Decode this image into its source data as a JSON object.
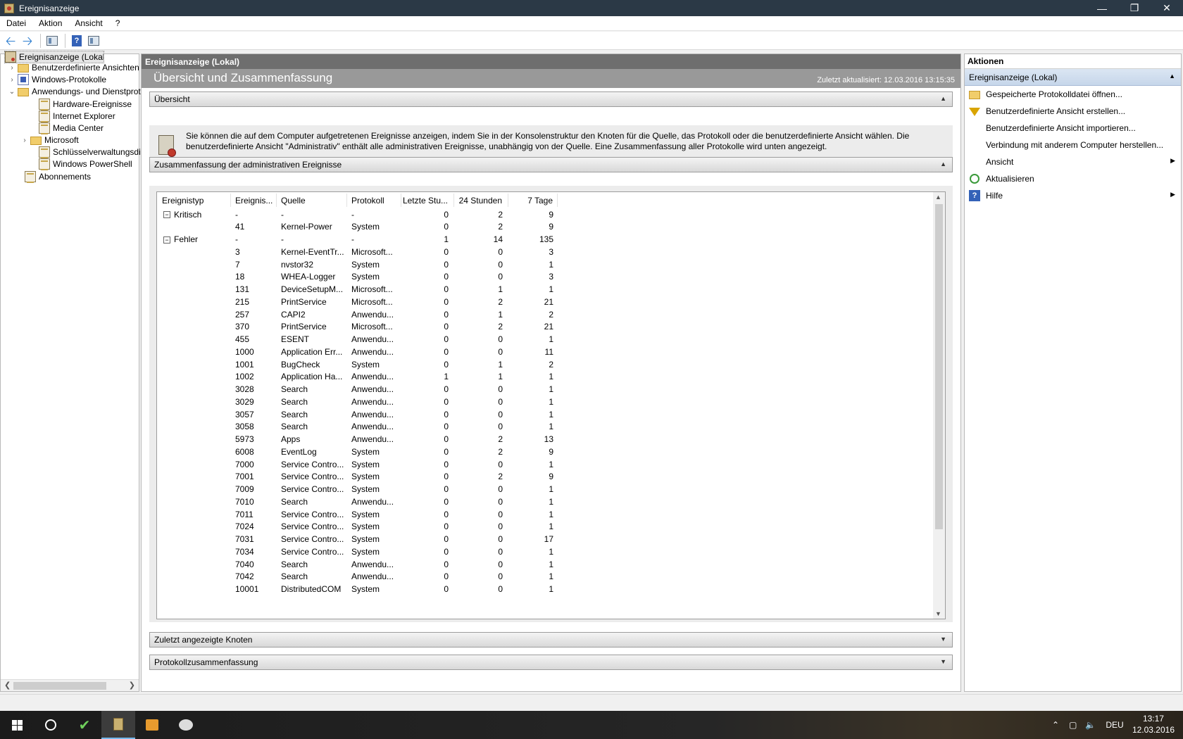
{
  "window": {
    "title": "Ereignisanzeige"
  },
  "menu": [
    "Datei",
    "Aktion",
    "Ansicht",
    "?"
  ],
  "tree": {
    "root": "Ereignisanzeige (Lokal)",
    "items": [
      {
        "label": "Benutzerdefinierte Ansichten",
        "icon": "folder-icon",
        "expander": "›"
      },
      {
        "label": "Windows-Protokolle",
        "icon": "windows-log-icon",
        "expander": "›"
      },
      {
        "label": "Anwendungs- und Dienstprotokolle",
        "icon": "folder-icon",
        "expander": "⌄"
      },
      {
        "label": "Hardware-Ereignisse",
        "icon": "log-icon",
        "expander": ""
      },
      {
        "label": "Internet Explorer",
        "icon": "log-icon",
        "expander": ""
      },
      {
        "label": "Media Center",
        "icon": "log-icon",
        "expander": ""
      },
      {
        "label": "Microsoft",
        "icon": "folder-icon",
        "expander": "›"
      },
      {
        "label": "Schlüsselverwaltungsdienst",
        "icon": "log-icon",
        "expander": ""
      },
      {
        "label": "Windows PowerShell",
        "icon": "log-icon",
        "expander": ""
      },
      {
        "label": "Abonnements",
        "icon": "subscription-icon",
        "expander": ""
      }
    ]
  },
  "center": {
    "header": "Ereignisanzeige (Lokal)",
    "title": "Übersicht und Zusammenfassung",
    "updated": "Zuletzt aktualisiert: 12.03.2016 13:15:35",
    "overview_label": "Übersicht",
    "overview_text": "Sie können die auf dem Computer aufgetretenen Ereignisse anzeigen, indem Sie in der Konsolenstruktur den Knoten für die Quelle, das Protokoll oder die benutzerdefinierte Ansicht wählen. Die benutzerdefinierte Ansicht \"Administrativ\" enthält alle administrativen Ereignisse, unabhängig von der Quelle. Eine Zusammenfassung aller Protokolle wird unten angezeigt.",
    "summary_label": "Zusammenfassung der administrativen Ereignisse",
    "recent_nodes_label": "Zuletzt angezeigte Knoten",
    "log_summary_label": "Protokollzusammenfassung"
  },
  "table": {
    "columns": [
      "Ereignistyp",
      "Ereignis...",
      "Quelle",
      "Protokoll",
      "Letzte Stu...",
      "24 Stunden",
      "7 Tage"
    ],
    "rows": [
      {
        "group": true,
        "type": "Kritisch",
        "id": "-",
        "source": "-",
        "log": "-",
        "h1": "0",
        "h24": "2",
        "d7": "9"
      },
      {
        "id": "41",
        "source": "Kernel-Power",
        "log": "System",
        "h1": "0",
        "h24": "2",
        "d7": "9"
      },
      {
        "group": true,
        "type": "Fehler",
        "id": "-",
        "source": "-",
        "log": "-",
        "h1": "1",
        "h24": "14",
        "d7": "135"
      },
      {
        "id": "3",
        "source": "Kernel-EventTr...",
        "log": "Microsoft...",
        "h1": "0",
        "h24": "0",
        "d7": "3"
      },
      {
        "id": "7",
        "source": "nvstor32",
        "log": "System",
        "h1": "0",
        "h24": "0",
        "d7": "1"
      },
      {
        "id": "18",
        "source": "WHEA-Logger",
        "log": "System",
        "h1": "0",
        "h24": "0",
        "d7": "3"
      },
      {
        "id": "131",
        "source": "DeviceSetupM...",
        "log": "Microsoft...",
        "h1": "0",
        "h24": "1",
        "d7": "1"
      },
      {
        "id": "215",
        "source": "PrintService",
        "log": "Microsoft...",
        "h1": "0",
        "h24": "2",
        "d7": "21"
      },
      {
        "id": "257",
        "source": "CAPI2",
        "log": "Anwendu...",
        "h1": "0",
        "h24": "1",
        "d7": "2"
      },
      {
        "id": "370",
        "source": "PrintService",
        "log": "Microsoft...",
        "h1": "0",
        "h24": "2",
        "d7": "21"
      },
      {
        "id": "455",
        "source": "ESENT",
        "log": "Anwendu...",
        "h1": "0",
        "h24": "0",
        "d7": "1"
      },
      {
        "id": "1000",
        "source": "Application Err...",
        "log": "Anwendu...",
        "h1": "0",
        "h24": "0",
        "d7": "11"
      },
      {
        "id": "1001",
        "source": "BugCheck",
        "log": "System",
        "h1": "0",
        "h24": "1",
        "d7": "2"
      },
      {
        "id": "1002",
        "source": "Application Ha...",
        "log": "Anwendu...",
        "h1": "1",
        "h24": "1",
        "d7": "1"
      },
      {
        "id": "3028",
        "source": "Search",
        "log": "Anwendu...",
        "h1": "0",
        "h24": "0",
        "d7": "1"
      },
      {
        "id": "3029",
        "source": "Search",
        "log": "Anwendu...",
        "h1": "0",
        "h24": "0",
        "d7": "1"
      },
      {
        "id": "3057",
        "source": "Search",
        "log": "Anwendu...",
        "h1": "0",
        "h24": "0",
        "d7": "1"
      },
      {
        "id": "3058",
        "source": "Search",
        "log": "Anwendu...",
        "h1": "0",
        "h24": "0",
        "d7": "1"
      },
      {
        "id": "5973",
        "source": "Apps",
        "log": "Anwendu...",
        "h1": "0",
        "h24": "2",
        "d7": "13"
      },
      {
        "id": "6008",
        "source": "EventLog",
        "log": "System",
        "h1": "0",
        "h24": "2",
        "d7": "9"
      },
      {
        "id": "7000",
        "source": "Service Contro...",
        "log": "System",
        "h1": "0",
        "h24": "0",
        "d7": "1"
      },
      {
        "id": "7001",
        "source": "Service Contro...",
        "log": "System",
        "h1": "0",
        "h24": "2",
        "d7": "9"
      },
      {
        "id": "7009",
        "source": "Service Contro...",
        "log": "System",
        "h1": "0",
        "h24": "0",
        "d7": "1"
      },
      {
        "id": "7010",
        "source": "Search",
        "log": "Anwendu...",
        "h1": "0",
        "h24": "0",
        "d7": "1"
      },
      {
        "id": "7011",
        "source": "Service Contro...",
        "log": "System",
        "h1": "0",
        "h24": "0",
        "d7": "1"
      },
      {
        "id": "7024",
        "source": "Service Contro...",
        "log": "System",
        "h1": "0",
        "h24": "0",
        "d7": "1"
      },
      {
        "id": "7031",
        "source": "Service Contro...",
        "log": "System",
        "h1": "0",
        "h24": "0",
        "d7": "17"
      },
      {
        "id": "7034",
        "source": "Service Contro...",
        "log": "System",
        "h1": "0",
        "h24": "0",
        "d7": "1"
      },
      {
        "id": "7040",
        "source": "Search",
        "log": "Anwendu...",
        "h1": "0",
        "h24": "0",
        "d7": "1"
      },
      {
        "id": "7042",
        "source": "Search",
        "log": "Anwendu...",
        "h1": "0",
        "h24": "0",
        "d7": "1"
      },
      {
        "id": "10001",
        "source": "DistributedCOM",
        "log": "System",
        "h1": "0",
        "h24": "0",
        "d7": "1"
      }
    ]
  },
  "actions": {
    "title": "Aktionen",
    "group": "Ereignisanzeige (Lokal)",
    "items": [
      {
        "label": "Gespeicherte Protokolldatei öffnen...",
        "icon": "open-folder-icon",
        "submenu": false
      },
      {
        "label": "Benutzerdefinierte Ansicht erstellen...",
        "icon": "filter-icon",
        "submenu": false
      },
      {
        "label": "Benutzerdefinierte Ansicht importieren...",
        "icon": "",
        "submenu": false
      },
      {
        "label": "Verbindung mit anderem Computer herstellen...",
        "icon": "",
        "submenu": false
      },
      {
        "label": "Ansicht",
        "icon": "",
        "submenu": true
      },
      {
        "label": "Aktualisieren",
        "icon": "refresh-icon",
        "submenu": false
      },
      {
        "label": "Hilfe",
        "icon": "help-icon",
        "submenu": true
      }
    ]
  },
  "taskbar": {
    "language": "DEU",
    "time": "13:17",
    "date": "12.03.2016"
  }
}
